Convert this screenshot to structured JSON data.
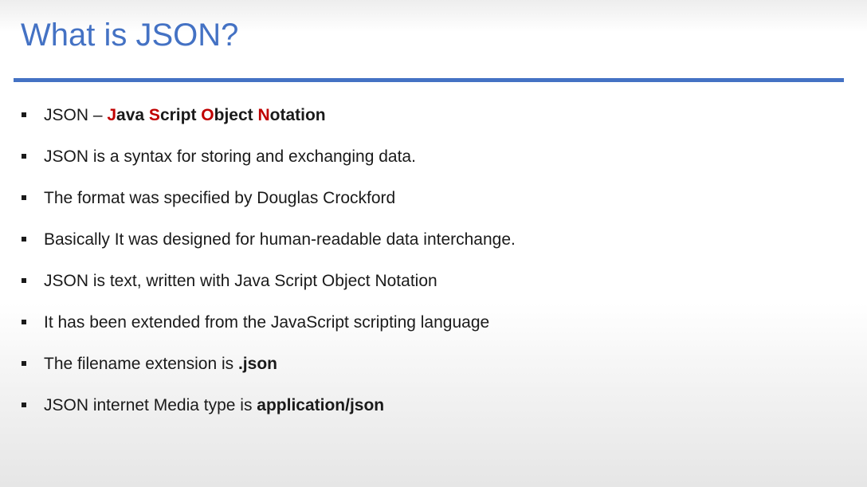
{
  "slide": {
    "title": "What is JSON?",
    "accent_color": "#4472c4",
    "highlight_color": "#c00000"
  },
  "bullets": [
    {
      "prefix": "JSON – ",
      "acronym": [
        {
          "initial": "J",
          "rest": "ava "
        },
        {
          "initial": "S",
          "rest": "cript "
        },
        {
          "initial": "O",
          "rest": "bject "
        },
        {
          "initial": "N",
          "rest": "otation"
        }
      ]
    },
    {
      "text": "JSON is a syntax for storing and exchanging data."
    },
    {
      "text": "The format was specified by Douglas Crockford"
    },
    {
      "text": "Basically It was designed for human-readable data interchange."
    },
    {
      "text": "JSON is text, written with Java Script Object Notation"
    },
    {
      "text": "It has been extended from the JavaScript scripting language"
    },
    {
      "text": "The filename extension is ",
      "bold": ".json"
    },
    {
      "text": "JSON internet Media type is ",
      "bold": "application/json"
    }
  ]
}
